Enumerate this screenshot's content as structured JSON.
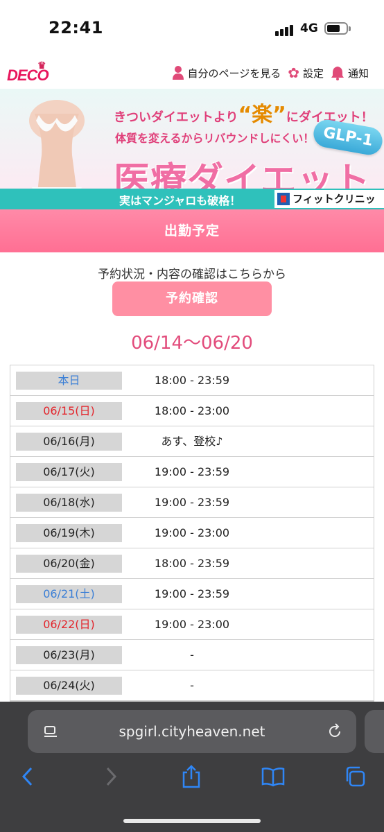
{
  "status": {
    "time": "22:41",
    "network": "4G"
  },
  "header": {
    "logo": "DECO",
    "links": [
      {
        "icon": "person-icon",
        "label": "自分のページを見る"
      },
      {
        "icon": "gear-icon",
        "label": "設定"
      },
      {
        "icon": "bell-icon",
        "label": "通知"
      }
    ]
  },
  "banner": {
    "line1_a": "きついダイエットより",
    "line1_b": "“楽”",
    "line1_c": "にダイエット！",
    "line2": "体質を変えるからリバウンドしにくい！",
    "badge": "GLP-1",
    "headline": "医療ダイエット",
    "strip_text": "実はマンジャロも破格！",
    "clinic": "フィットクリニック"
  },
  "section_title": "出勤予定",
  "notice": "予約状況・内容の確認はこちらから",
  "reserve_button": "予約確認",
  "range": "06/14〜06/20",
  "schedule": [
    {
      "day": "本日",
      "value": "18:00 - 23:59",
      "type": "today"
    },
    {
      "day": "06/15(日)",
      "value": "18:00 - 23:00",
      "type": "sun"
    },
    {
      "day": "06/16(月)",
      "value": "あす、登校♪",
      "type": "weekday"
    },
    {
      "day": "06/17(火)",
      "value": "19:00 - 23:59",
      "type": "weekday"
    },
    {
      "day": "06/18(水)",
      "value": "19:00 - 23:59",
      "type": "weekday"
    },
    {
      "day": "06/19(木)",
      "value": "19:00 - 23:00",
      "type": "weekday"
    },
    {
      "day": "06/20(金)",
      "value": "18:00 - 23:59",
      "type": "weekday"
    },
    {
      "day": "06/21(土)",
      "value": "19:00 - 23:59",
      "type": "sat"
    },
    {
      "day": "06/22(日)",
      "value": "19:00 - 23:00",
      "type": "sun"
    },
    {
      "day": "06/23(月)",
      "value": "-",
      "type": "weekday"
    },
    {
      "day": "06/24(火)",
      "value": "-",
      "type": "weekday"
    }
  ],
  "browser": {
    "url": "spgirl.cityheaven.net"
  },
  "colors": {
    "accent_pink": "#ff6f93",
    "today_blue": "#3b7fd6",
    "sunday_red": "#e3242b"
  }
}
